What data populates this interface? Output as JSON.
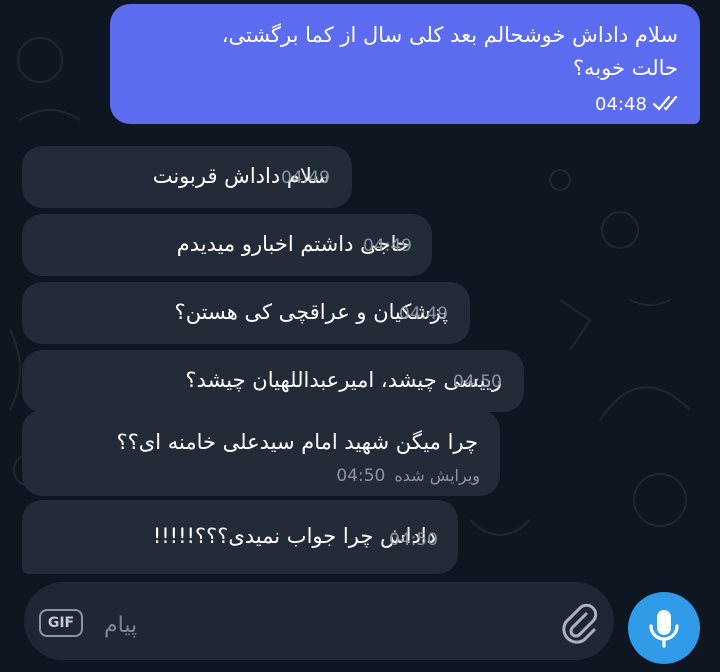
{
  "messages": [
    {
      "direction": "outgoing",
      "lines": [
        "سلام داداش خوشحالم بعد کلی سال از کما برگشتی،",
        "حالت خوبه؟"
      ],
      "time": "04:48",
      "status": "read"
    },
    {
      "direction": "incoming",
      "text": "سلام داداش قربونت",
      "time": "04:49"
    },
    {
      "direction": "incoming",
      "text": "حاجی داشتم اخبارو میدیدم",
      "time": "04:49"
    },
    {
      "direction": "incoming",
      "text": "پزشکیان و عراقچی کی هستن؟",
      "time": "04:49"
    },
    {
      "direction": "incoming",
      "text": "رییسی چیشد، امیرعبداللهیان چیشد؟",
      "time": "04:50"
    },
    {
      "direction": "incoming",
      "text": "چرا میگن شهید امام سیدعلی خامنه ای؟؟",
      "edited": "ویرایش شده",
      "time": "04:50"
    },
    {
      "direction": "incoming",
      "text": "داداش چرا جواب نمیدی؟؟؟!!!!!",
      "time": "04:50"
    }
  ],
  "composer": {
    "placeholder": "پیام",
    "gif_label": "GIF"
  },
  "icons": {
    "read_status": "double-check-icon",
    "attach": "paperclip-icon",
    "mic": "microphone-icon"
  },
  "colors": {
    "background": "#0e1621",
    "outgoing_bubble": "#5b6cf0",
    "incoming_bubble": "#222b37",
    "mic_button": "#2f9be9"
  }
}
